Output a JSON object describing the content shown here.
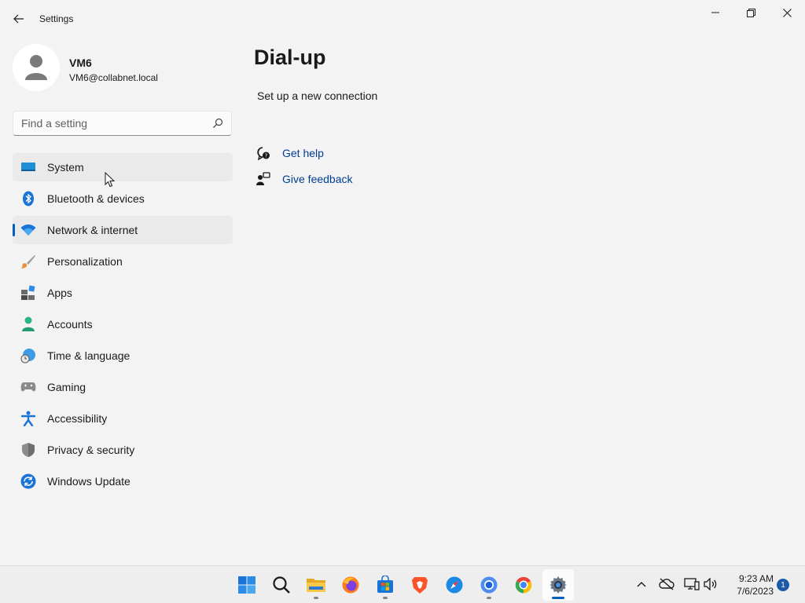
{
  "window": {
    "title": "Settings",
    "controls": {
      "minimize": "minimize-icon",
      "maximize": "restore-icon",
      "close": "close-icon"
    }
  },
  "profile": {
    "name": "VM6",
    "email": "VM6@collabnet.local"
  },
  "search": {
    "placeholder": "Find a setting",
    "value": ""
  },
  "sidebar": {
    "items": [
      {
        "label": "System",
        "icon": "monitor-icon",
        "state": "hover"
      },
      {
        "label": "Bluetooth & devices",
        "icon": "bluetooth-icon"
      },
      {
        "label": "Network & internet",
        "icon": "wifi-icon",
        "state": "selected"
      },
      {
        "label": "Personalization",
        "icon": "brush-icon"
      },
      {
        "label": "Apps",
        "icon": "apps-icon"
      },
      {
        "label": "Accounts",
        "icon": "person-icon"
      },
      {
        "label": "Time & language",
        "icon": "globe-clock-icon"
      },
      {
        "label": "Gaming",
        "icon": "gamepad-icon"
      },
      {
        "label": "Accessibility",
        "icon": "accessibility-icon"
      },
      {
        "label": "Privacy & security",
        "icon": "shield-icon"
      },
      {
        "label": "Windows Update",
        "icon": "update-icon"
      }
    ]
  },
  "main": {
    "title": "Dial-up",
    "setup_link": "Set up a new connection",
    "help": {
      "get_help": "Get help",
      "give_feedback": "Give feedback"
    }
  },
  "taskbar": {
    "apps": [
      {
        "name": "start",
        "icon": "windows-logo-icon"
      },
      {
        "name": "search",
        "icon": "search-icon"
      },
      {
        "name": "file-explorer",
        "icon": "folder-icon",
        "running": true
      },
      {
        "name": "firefox",
        "icon": "firefox-icon"
      },
      {
        "name": "microsoft-store",
        "icon": "store-icon",
        "running": true
      },
      {
        "name": "brave",
        "icon": "brave-icon"
      },
      {
        "name": "safari",
        "icon": "compass-icon"
      },
      {
        "name": "chromium",
        "icon": "chromium-icon",
        "running": true
      },
      {
        "name": "chrome",
        "icon": "chrome-icon"
      },
      {
        "name": "settings",
        "icon": "gear-icon",
        "running": true,
        "active": true
      }
    ],
    "tray": {
      "icons": [
        "chevron-up-icon",
        "cloud-offline-icon",
        "network-icon",
        "volume-icon"
      ],
      "time": "9:23 AM",
      "date": "7/6/2023",
      "notifications": "1"
    }
  },
  "colors": {
    "accent": "#005fb8",
    "background": "#f3f3f3",
    "link": "#003e92"
  }
}
